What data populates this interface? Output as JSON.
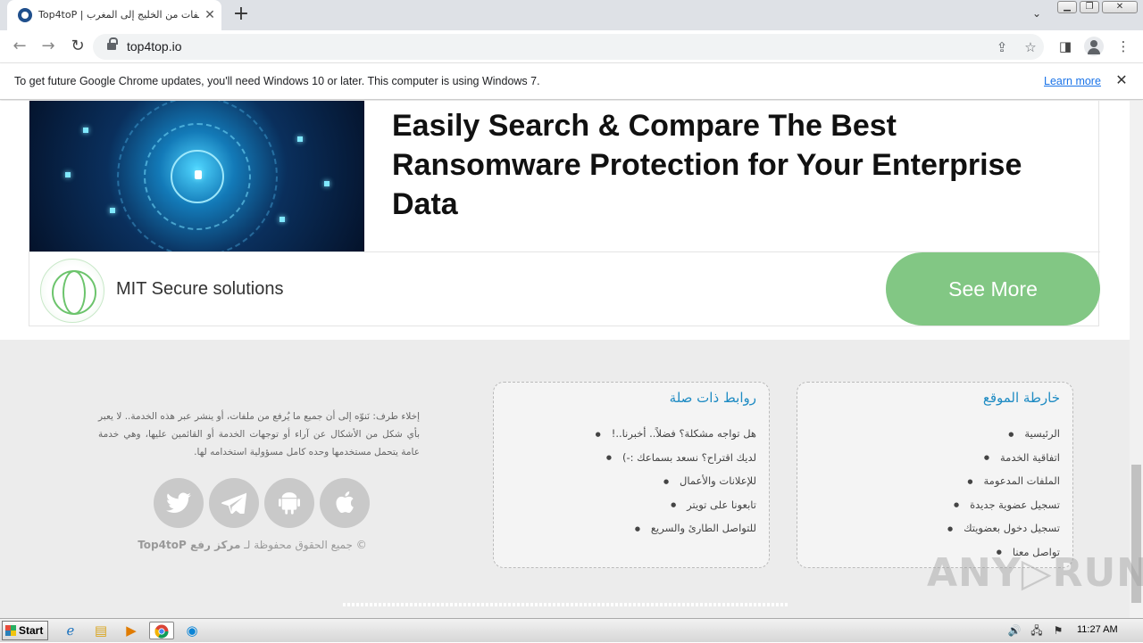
{
  "browser": {
    "tab": {
      "title": "Top4toP | ملفات من الخليج إلى المغرب"
    },
    "new_tab_symbol": "+",
    "tab_search_symbol": "⌄",
    "address": {
      "url": "top4top.io"
    },
    "infobar": {
      "message": "To get future Google Chrome updates, you'll need Windows 10 or later. This computer is using Windows 7.",
      "link": "Learn more"
    }
  },
  "ad": {
    "headline": "Easily Search & Compare The Best Ransomware Protection for Your Enterprise Data",
    "brand": "MIT Secure solutions",
    "cta": "See More",
    "cta_color": "#82c784"
  },
  "footer": {
    "disclaimer": "إخلاء طرف: نَنوّه إلى أن جميع ما يُرفع من ملفات، أو ينشر عبر هذه الخدمة.. لا يعبر بأي شكل من الأشكال عن آراء أو توجهات الخدمة أو القائمين عليها، وهي خدمة عامة يتحمل مستخدمها وحده كامل مسؤولية استخدامه لها.",
    "social": [
      {
        "name": "twitter-icon",
        "glyph": "🐦"
      },
      {
        "name": "telegram-icon",
        "glyph": "➤"
      },
      {
        "name": "android-icon",
        "glyph": "🤖"
      },
      {
        "name": "apple-icon",
        "glyph": ""
      }
    ],
    "copyright_prefix": "© جميع الحقوق محفوظة لـ",
    "copyright_brand": "مركز رفع Top4toP",
    "related_links": {
      "title": "روابط ذات صلة",
      "items": [
        "هل تواجه مشكلة؟ فضلاً.. أخبرنا..!",
        "لديك اقتراح؟ نسعد بسماعك :-)",
        "للإعلانات والأعمال",
        "تابعونا على تويتر",
        "للتواصل الطارئ والسريع"
      ]
    },
    "sitemap": {
      "title": "خارطة الموقع",
      "items": [
        "الرئيسية",
        "اتفاقية الخدمة",
        "الملفات المدعومة",
        "تسجيل عضوية جديدة",
        "تسجيل دخول بعضويتك",
        "تواصل معنا"
      ]
    },
    "accent_color": "#1e8bc3"
  },
  "watermark": "ANY▷RUN",
  "taskbar": {
    "start_label": "Start",
    "clock": "11:27 AM"
  }
}
